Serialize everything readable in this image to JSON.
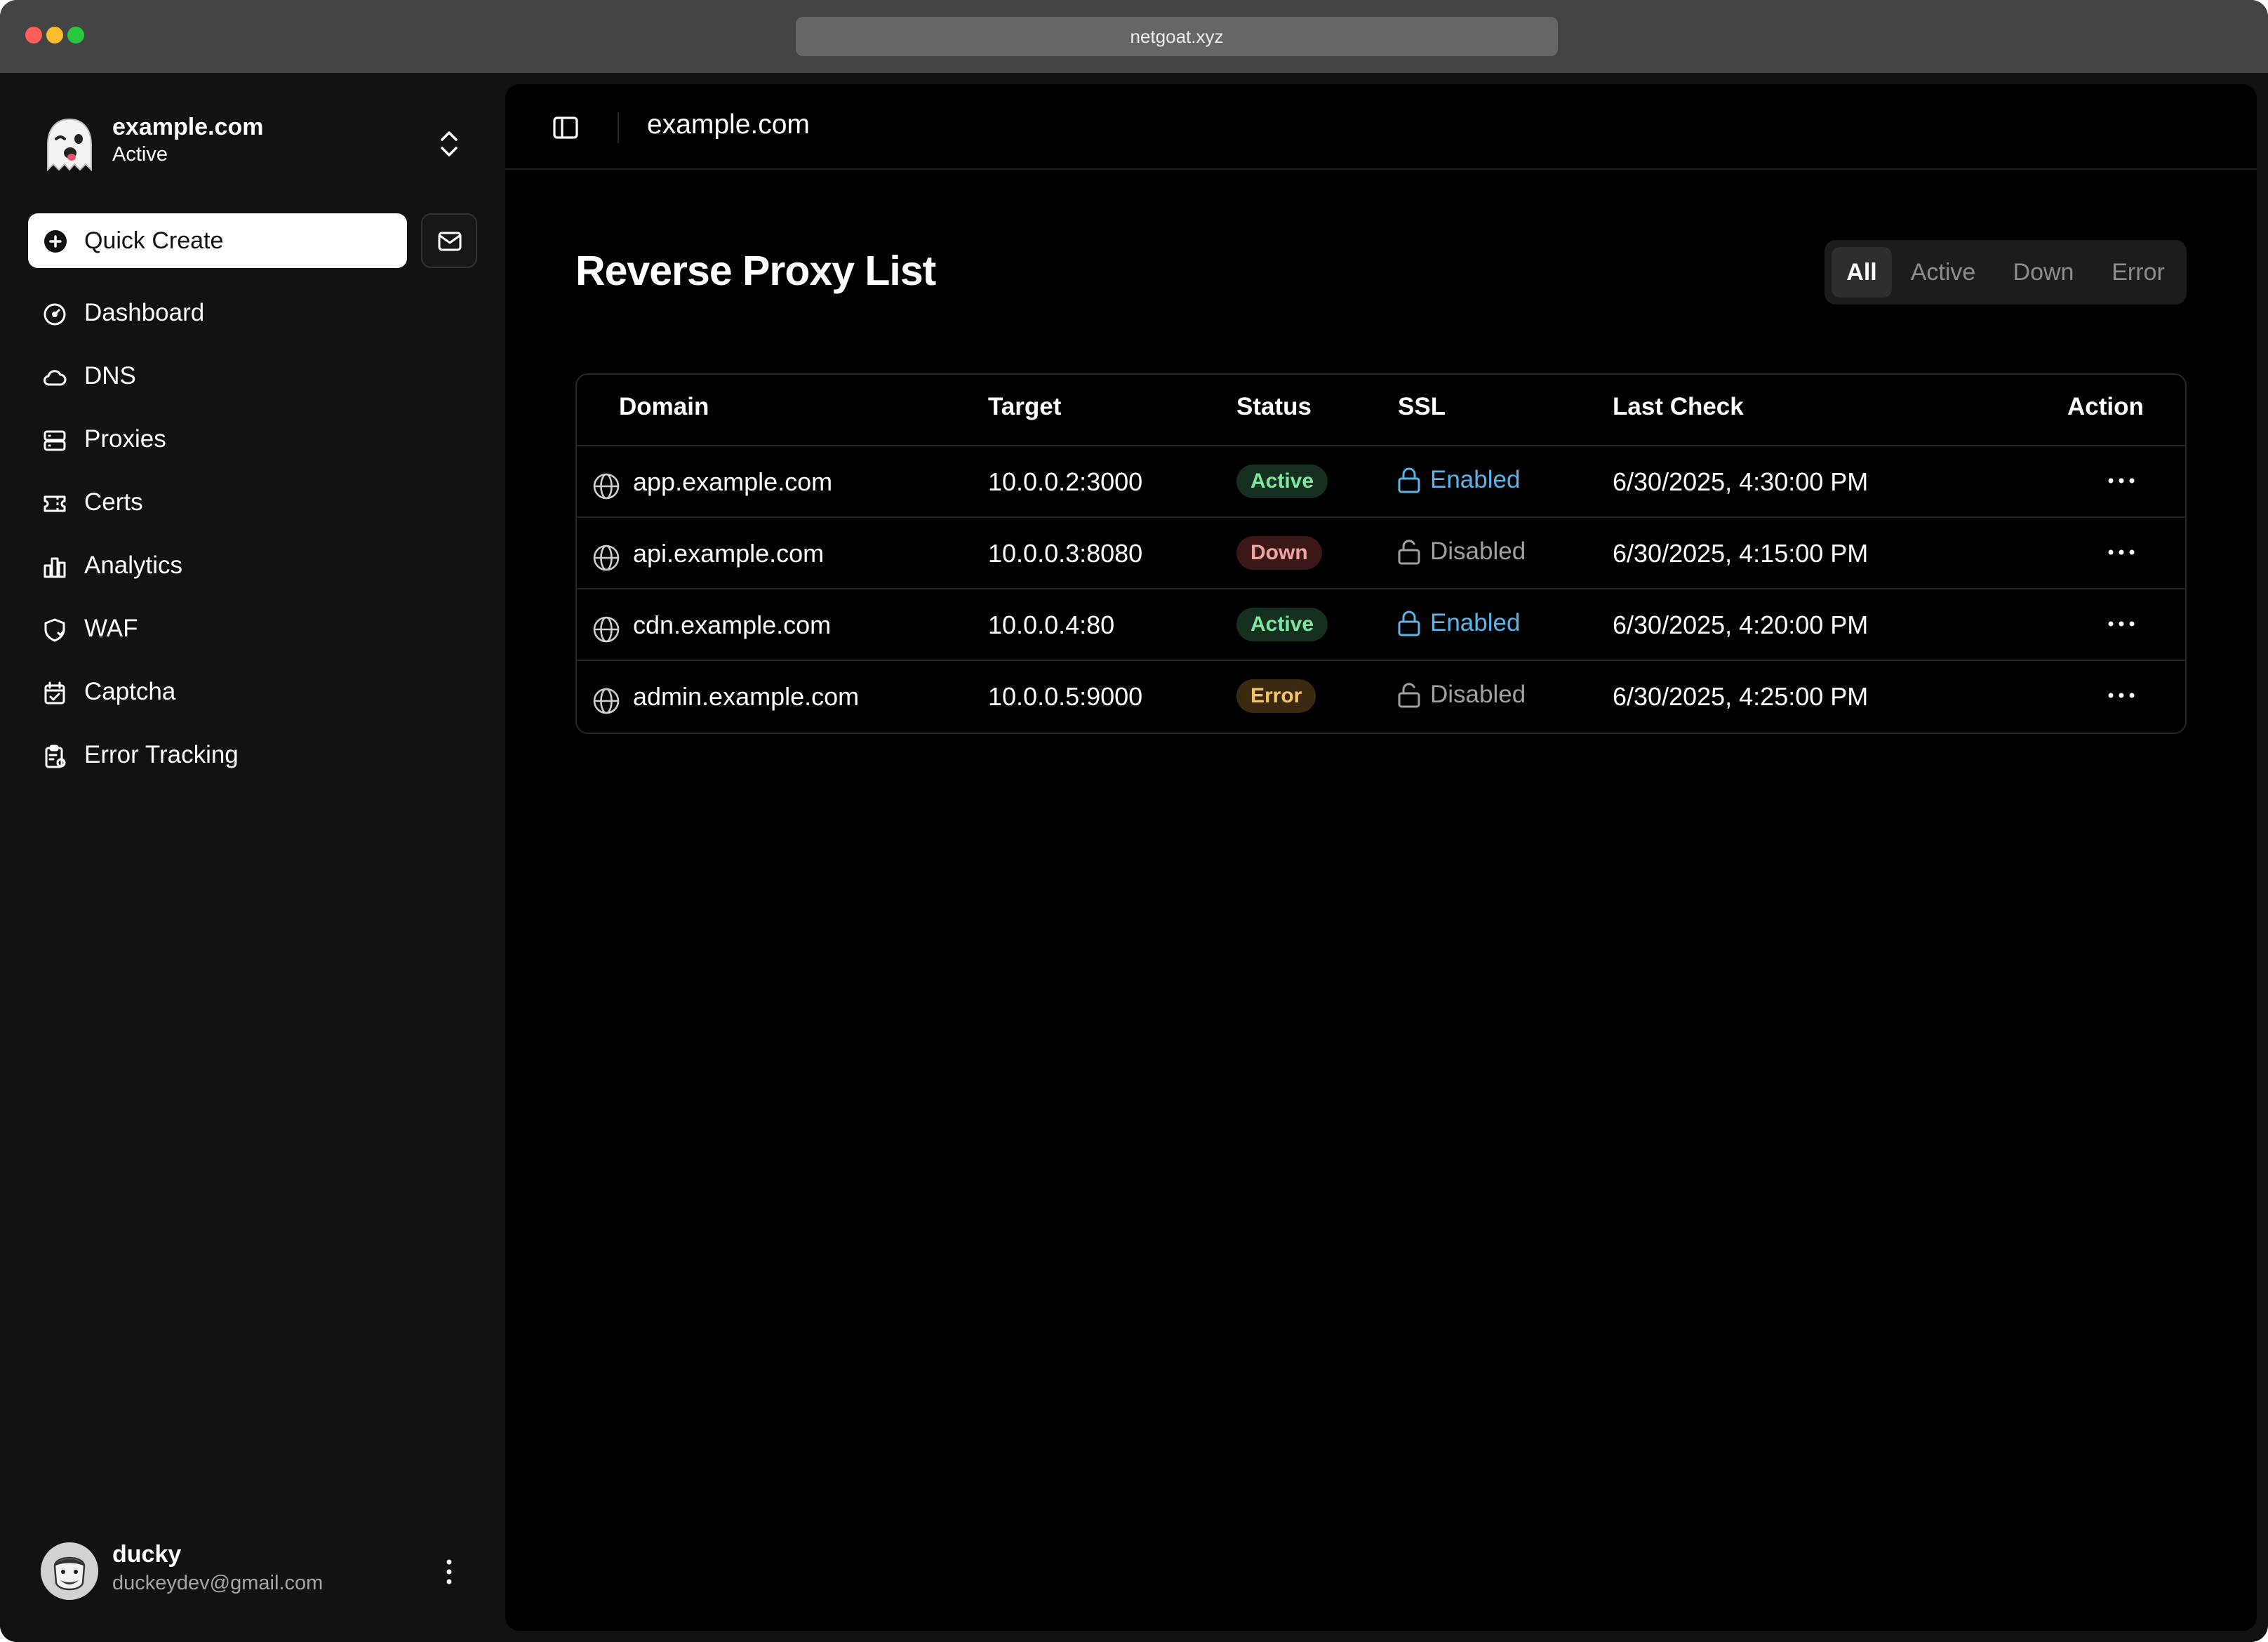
{
  "browser": {
    "url": "netgoat.xyz"
  },
  "colors": {
    "light_red": "#ff5f57",
    "light_yellow": "#febc2e",
    "light_green": "#28c840",
    "ssl_enabled": "#5ab4e8",
    "active": "#7ee8a1",
    "down": "#f0a3a3",
    "error": "#f4c36a"
  },
  "sidebar": {
    "team": {
      "name": "example.com",
      "status": "Active",
      "logo_icon": "ghost-icon"
    },
    "quick_create_label": "Quick Create",
    "items": [
      {
        "label": "Dashboard",
        "icon": "gauge-icon"
      },
      {
        "label": "DNS",
        "icon": "cloud-icon"
      },
      {
        "label": "Proxies",
        "icon": "server-icon"
      },
      {
        "label": "Certs",
        "icon": "ticket-icon"
      },
      {
        "label": "Analytics",
        "icon": "bar-chart-icon"
      },
      {
        "label": "WAF",
        "icon": "shield-icon"
      },
      {
        "label": "Captcha",
        "icon": "calendar-check-icon"
      },
      {
        "label": "Error Tracking",
        "icon": "clipboard-icon"
      }
    ],
    "user": {
      "name": "ducky",
      "email": "duckeydev@gmail.com"
    }
  },
  "header": {
    "breadcrumb": "example.com"
  },
  "main": {
    "title": "Reverse Proxy List",
    "filters": [
      "All",
      "Active",
      "Down",
      "Error"
    ],
    "selected_filter": "All",
    "table": {
      "columns": [
        "Domain",
        "Target",
        "Status",
        "SSL",
        "Last Check",
        "Action"
      ],
      "rows": [
        {
          "domain": "app.example.com",
          "target": "10.0.0.2:3000",
          "status": "Active",
          "ssl": "Enabled",
          "last_check": "6/30/2025, 4:30:00 PM"
        },
        {
          "domain": "api.example.com",
          "target": "10.0.0.3:8080",
          "status": "Down",
          "ssl": "Disabled",
          "last_check": "6/30/2025, 4:15:00 PM"
        },
        {
          "domain": "cdn.example.com",
          "target": "10.0.0.4:80",
          "status": "Active",
          "ssl": "Enabled",
          "last_check": "6/30/2025, 4:20:00 PM"
        },
        {
          "domain": "admin.example.com",
          "target": "10.0.0.5:9000",
          "status": "Error",
          "ssl": "Disabled",
          "last_check": "6/30/2025, 4:25:00 PM"
        }
      ]
    }
  }
}
